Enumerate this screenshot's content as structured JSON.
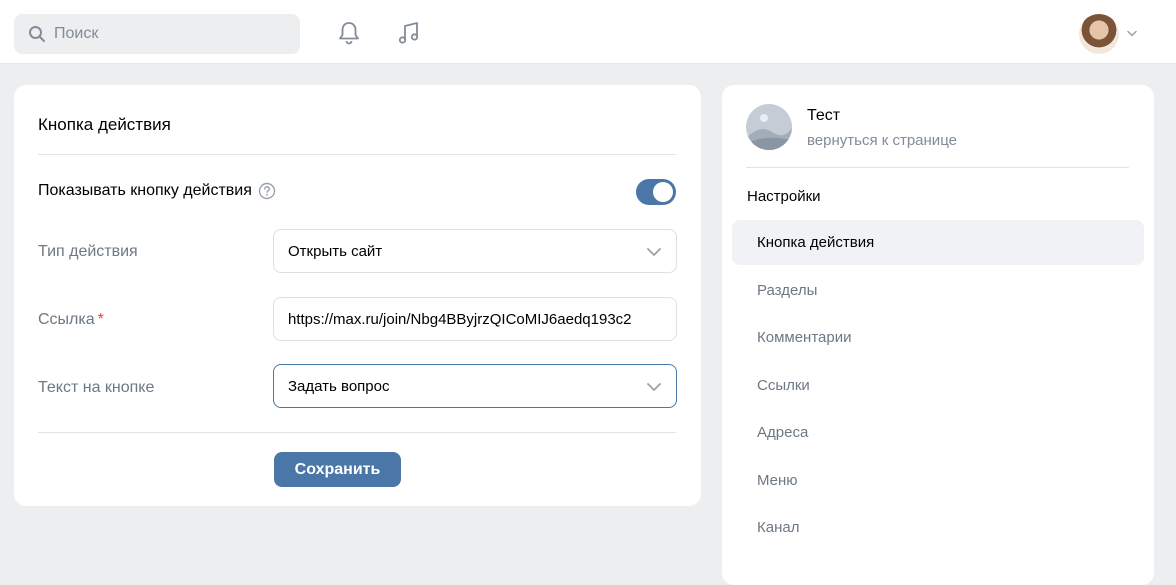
{
  "topbar": {
    "search_placeholder": "Поиск",
    "icons": [
      "search-icon",
      "bell-icon",
      "music-icon",
      "chevron-down-icon"
    ]
  },
  "form": {
    "title": "Кнопка действия",
    "toggle_label": "Показывать кнопку действия",
    "toggle_on": true,
    "fields": {
      "action_type": {
        "label": "Тип действия",
        "value": "Открыть сайт"
      },
      "link": {
        "label": "Ссылка",
        "required_mark": "*",
        "value": "https://max.ru/join/Nbg4BByjrzQICoMIJ6aedq193c2"
      },
      "button_text": {
        "label": "Текст на кнопке",
        "value": "Задать вопрос"
      }
    },
    "save_label": "Сохранить"
  },
  "sidebar": {
    "name": "Тест",
    "back_link": "вернуться к странице",
    "heading": "Настройки",
    "items": [
      {
        "label": "Кнопка действия",
        "active": true
      },
      {
        "label": "Разделы"
      },
      {
        "label": "Комментарии"
      },
      {
        "label": "Ссылки"
      },
      {
        "label": "Адреса"
      },
      {
        "label": "Меню"
      },
      {
        "label": "Канал"
      }
    ]
  },
  "colors": {
    "accent": "#4a76a8",
    "background": "#edeef0",
    "muted_text": "#6d7885",
    "required": "#e64646"
  }
}
